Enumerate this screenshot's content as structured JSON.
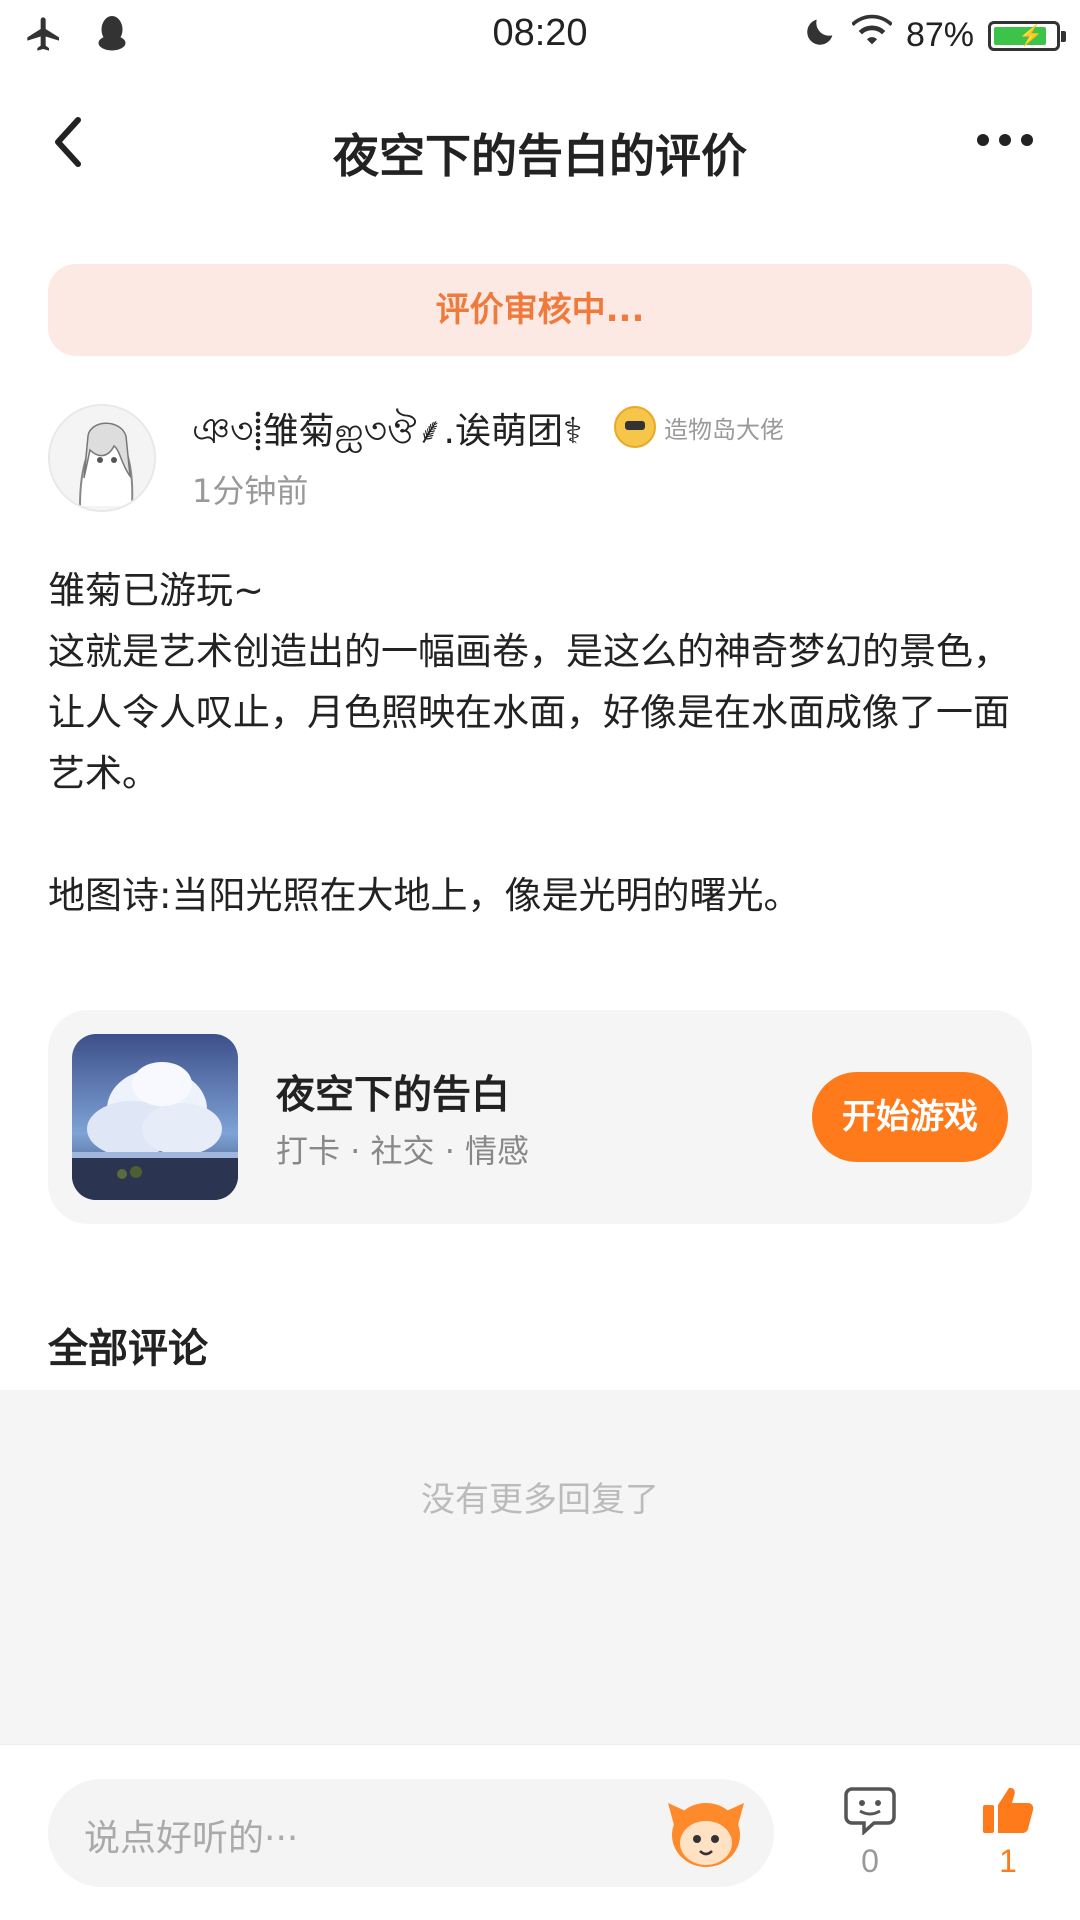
{
  "status_bar": {
    "time": "08:20",
    "battery": "87%",
    "battery_level": 0.87
  },
  "nav": {
    "title": "夜空下的告白的评价"
  },
  "review_banner": "评价审核中...",
  "user": {
    "name": "ঞ৩⸽雏菊ஐ৩ঔ⸙.诶萌团⚕",
    "badge": "造物岛大佬",
    "time": "1分钟前"
  },
  "review": {
    "text": "雏菊已游玩~\n这就是艺术创造出的一幅画卷，是这么的神奇梦幻的景色，让人令人叹止，月色照映在水面，好像是在水面成像了一面艺术。\n\n地图诗:当阳光照在大地上，像是光明的曙光。"
  },
  "game": {
    "name": "夜空下的告白",
    "tags": "打卡 · 社交 · 情感",
    "play_label": "开始游戏"
  },
  "comments": {
    "title": "全部评论",
    "empty_text": "没有更多回复了"
  },
  "bottom_bar": {
    "input_placeholder": "说点好听的···",
    "comment_count": "0",
    "like_count": "1",
    "accent_color": "#ff7a1a"
  }
}
